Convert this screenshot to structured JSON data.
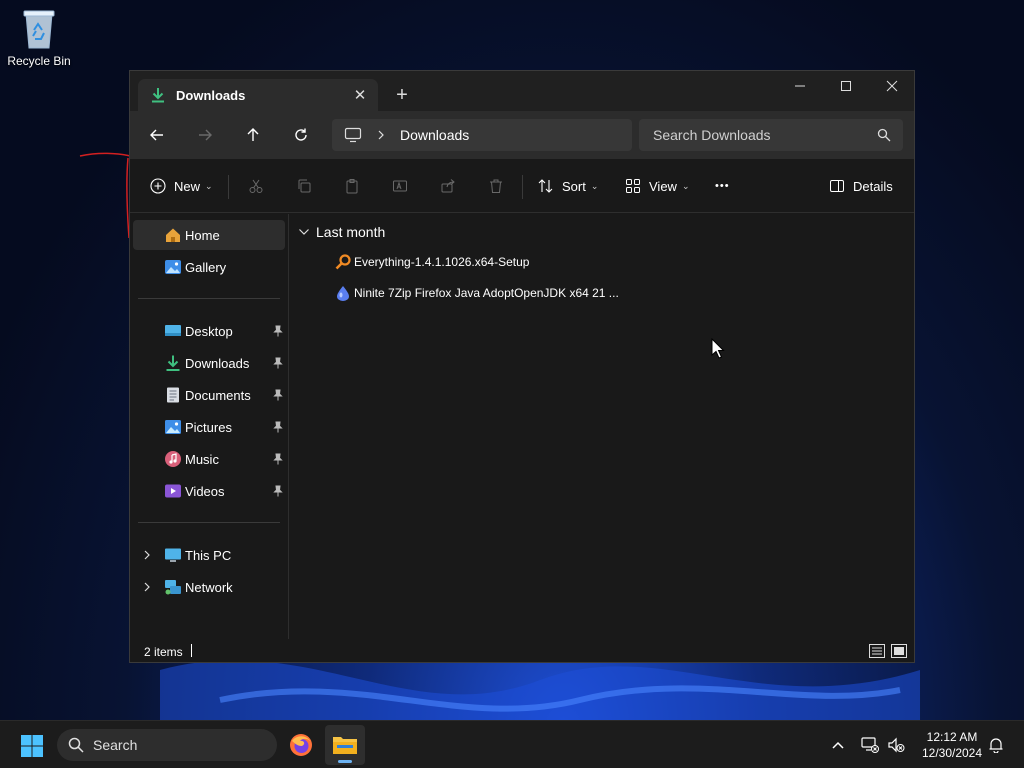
{
  "desktop": {
    "recycle_bin_label": "Recycle Bin"
  },
  "window": {
    "tab_title": "Downloads",
    "tab_close_glyph": "✕",
    "new_tab_glyph": "+",
    "address": {
      "crumbs": [
        "Downloads"
      ]
    },
    "search": {
      "placeholder": "Search Downloads"
    },
    "toolbar": {
      "new_label": "New",
      "sort_label": "Sort",
      "view_label": "View",
      "details_label": "Details",
      "more_glyph": "•••",
      "dropdown_glyph": "⌄"
    },
    "sidebar": {
      "top_items": [
        {
          "label": "Home",
          "icon": "home-icon"
        },
        {
          "label": "Gallery",
          "icon": "gallery-icon"
        }
      ],
      "pinned_items": [
        {
          "label": "Desktop",
          "icon": "desktop-folder-icon"
        },
        {
          "label": "Downloads",
          "icon": "downloads-folder-icon"
        },
        {
          "label": "Documents",
          "icon": "documents-folder-icon"
        },
        {
          "label": "Pictures",
          "icon": "pictures-folder-icon"
        },
        {
          "label": "Music",
          "icon": "music-folder-icon"
        },
        {
          "label": "Videos",
          "icon": "videos-folder-icon"
        }
      ],
      "location_items": [
        {
          "label": "This PC",
          "icon": "this-pc-icon"
        },
        {
          "label": "Network",
          "icon": "network-icon"
        }
      ]
    },
    "content": {
      "group_header": "Last month",
      "files": [
        {
          "name": "Everything-1.4.1.1026.x64-Setup",
          "icon": "everything-app-icon"
        },
        {
          "name": "Ninite 7Zip Firefox Java AdoptOpenJDK x64 21 ...",
          "icon": "ninite-app-icon"
        }
      ]
    },
    "status": {
      "item_count": "2 items"
    }
  },
  "taskbar": {
    "search_label": "Search",
    "time": "12:12 AM",
    "date": "12/30/2024"
  },
  "colors": {
    "accent": "#6db3f2",
    "window_bg": "#191919",
    "navbar_bg": "#2c2c2c",
    "downloads_green": "#3fc080"
  }
}
